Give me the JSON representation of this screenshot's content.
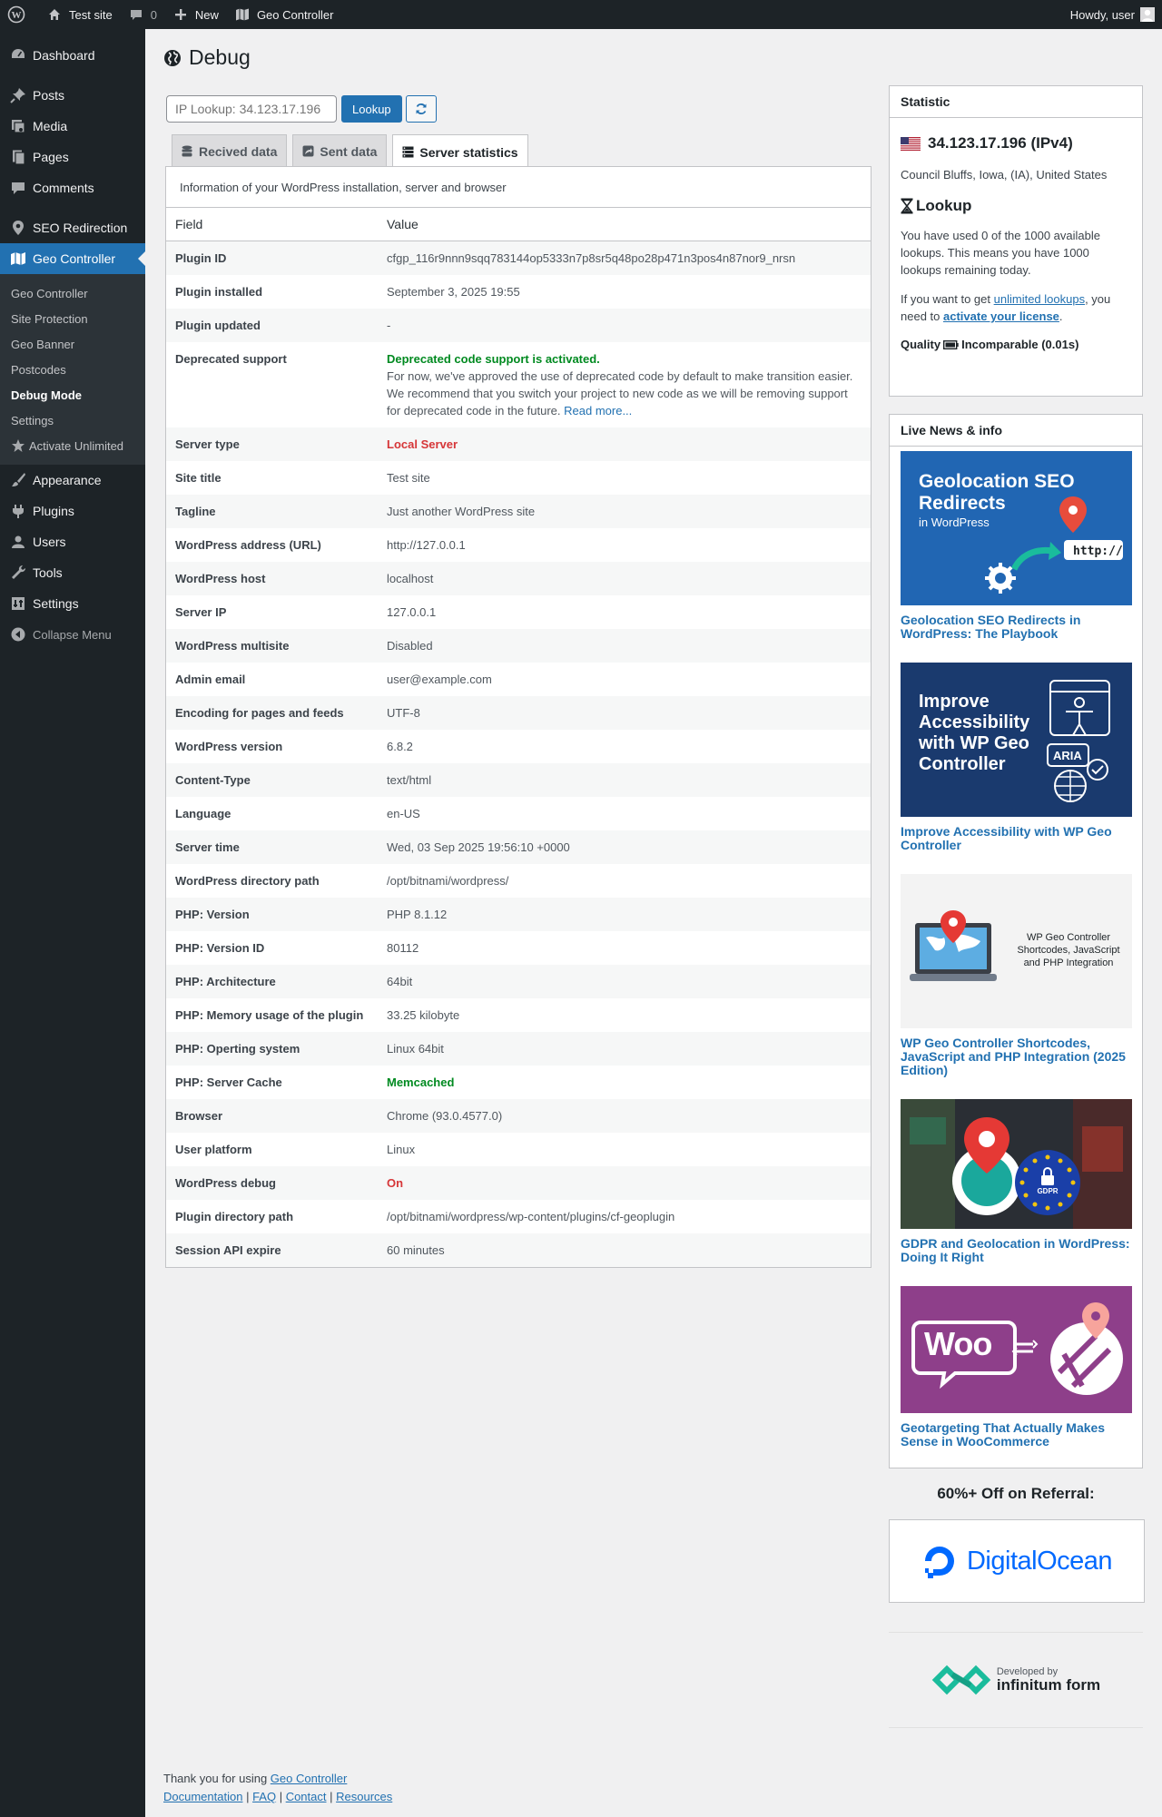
{
  "adminbar": {
    "site_name": "Test site",
    "comments_count": "0",
    "new_label": "New",
    "plugin_label": "Geo Controller",
    "howdy": "Howdy, user"
  },
  "sidebar": {
    "items_top": [
      {
        "label": "Dashboard",
        "icon": "dashboard-icon"
      },
      {
        "label": "Posts",
        "icon": "pin-icon"
      },
      {
        "label": "Media",
        "icon": "media-icon"
      },
      {
        "label": "Pages",
        "icon": "pages-icon"
      },
      {
        "label": "Comments",
        "icon": "comments-icon"
      },
      {
        "label": "SEO Redirection",
        "icon": "location-icon"
      },
      {
        "label": "Geo Controller",
        "icon": "map-icon"
      }
    ],
    "submenu": [
      "Geo Controller",
      "Site Protection",
      "Geo Banner",
      "Postcodes",
      "Debug Mode",
      "Settings",
      "Activate Unlimited"
    ],
    "items_bottom": [
      {
        "label": "Appearance",
        "icon": "brush-icon"
      },
      {
        "label": "Plugins",
        "icon": "plug-icon"
      },
      {
        "label": "Users",
        "icon": "user-icon"
      },
      {
        "label": "Tools",
        "icon": "wrench-icon"
      },
      {
        "label": "Settings",
        "icon": "settings-icon"
      },
      {
        "label": "Collapse Menu",
        "icon": "collapse-icon"
      }
    ]
  },
  "page": {
    "title": "Debug",
    "lookup_placeholder": "IP Lookup: 34.123.17.196",
    "lookup_button": "Lookup",
    "tabs": [
      "Recived data",
      "Sent data",
      "Server statistics"
    ],
    "description": "Information of your WordPress installation, server and browser",
    "col_field": "Field",
    "col_value": "Value"
  },
  "rows": [
    {
      "field": "Plugin ID",
      "value": "cfgp_116r9nnn9sqq783144op5333n7p8sr5q48po28p471n3pos4n87nor9_nrsn"
    },
    {
      "field": "Plugin installed",
      "value": "September 3, 2025 19:55"
    },
    {
      "field": "Plugin updated",
      "value": "-"
    },
    {
      "field": "Deprecated support",
      "value": "Deprecated code support is activated.",
      "note": "For now, we've approved the use of deprecated code by default to make transition easier. We recommend that you switch your project to new code as we will be removing support for deprecated code in the future.",
      "link": "Read more..."
    },
    {
      "field": "Server type",
      "value": "Local Server"
    },
    {
      "field": "Site title",
      "value": "Test site"
    },
    {
      "field": "Tagline",
      "value": "Just another WordPress site"
    },
    {
      "field": "WordPress address (URL)",
      "value": "http://127.0.0.1"
    },
    {
      "field": "WordPress host",
      "value": "localhost"
    },
    {
      "field": "Server IP",
      "value": "127.0.0.1"
    },
    {
      "field": "WordPress multisite",
      "value": "Disabled"
    },
    {
      "field": "Admin email",
      "value": "user@example.com"
    },
    {
      "field": "Encoding for pages and feeds",
      "value": "UTF-8"
    },
    {
      "field": "WordPress version",
      "value": "6.8.2"
    },
    {
      "field": "Content-Type",
      "value": "text/html"
    },
    {
      "field": "Language",
      "value": "en-US"
    },
    {
      "field": "Server time",
      "value": "Wed, 03 Sep 2025 19:56:10 +0000"
    },
    {
      "field": "WordPress directory path",
      "value": "/opt/bitnami/wordpress/"
    },
    {
      "field": "PHP: Version",
      "value": "PHP 8.1.12"
    },
    {
      "field": "PHP: Version ID",
      "value": "80112"
    },
    {
      "field": "PHP: Architecture",
      "value": "64bit"
    },
    {
      "field": "PHP: Memory usage of the plugin",
      "value": "33.25 kilobyte"
    },
    {
      "field": "PHP: Operting system",
      "value": "Linux 64bit"
    },
    {
      "field": "PHP: Server Cache",
      "value": "Memcached"
    },
    {
      "field": "Browser",
      "value": "Chrome (93.0.4577.0)"
    },
    {
      "field": "User platform",
      "value": "Linux"
    },
    {
      "field": "WordPress debug",
      "value": "On"
    },
    {
      "field": "Plugin directory path",
      "value": "/opt/bitnami/wordpress/wp-content/plugins/cf-geoplugin"
    },
    {
      "field": "Session API expire",
      "value": "60 minutes"
    }
  ],
  "statistic": {
    "title": "Statistic",
    "ip": "34.123.17.196 (IPv4)",
    "location": "Council Bluffs, Iowa, (IA), United States",
    "lookup_title": "Lookup",
    "usage": "You have used 0 of the 1000 available lookups. This means you have 1000 lookups remaining today.",
    "cta_pre": "If you want to get ",
    "cta_link1": "unlimited lookups",
    "cta_mid": ", you need to ",
    "cta_link2": "activate your license",
    "cta_post": ".",
    "quality_label": "Quality",
    "quality_value": "Incomparable (0.01s)"
  },
  "news": {
    "title": "Live News & info",
    "items": [
      {
        "title": "Geolocation SEO Redirects in WordPress: The Playbook",
        "img_lines": [
          "Geolocation SEO",
          "Redirects",
          "in WordPress"
        ],
        "img_tag": "http://"
      },
      {
        "title": "Improve Accessibility with WP Geo Controller",
        "img_lines": [
          "Improve",
          "Accessibility",
          "with WP Geo",
          "Controller"
        ],
        "img_tag": "ARIA"
      },
      {
        "title": "WP Geo Controller Shortcodes, JavaScript and PHP Integration (2025 Edition)",
        "img_lines": [
          "WP Geo Controller",
          "Shortcodes, JavaScript",
          "and PHP Integration"
        ]
      },
      {
        "title": "GDPR and Geolocation in WordPress: Doing It Right",
        "img_tag": "GDPR"
      },
      {
        "title": "Geotargeting That Actually Makes Sense in WooCommerce",
        "img_tag": "Woo"
      }
    ]
  },
  "referral": {
    "title": "60%+ Off on Referral:",
    "brand": "DigitalOcean"
  },
  "developer": {
    "line1": "Developed by",
    "line2": "infinitum form"
  },
  "footer": {
    "thanks_pre": "Thank you for using ",
    "thanks_link": "Geo Controller",
    "links": [
      "Documentation",
      "FAQ",
      "Contact",
      "Resources"
    ]
  },
  "colors": {
    "accent": "#2271b1",
    "sidebar": "#1d2327",
    "green": "#008a20",
    "red": "#d63638"
  }
}
